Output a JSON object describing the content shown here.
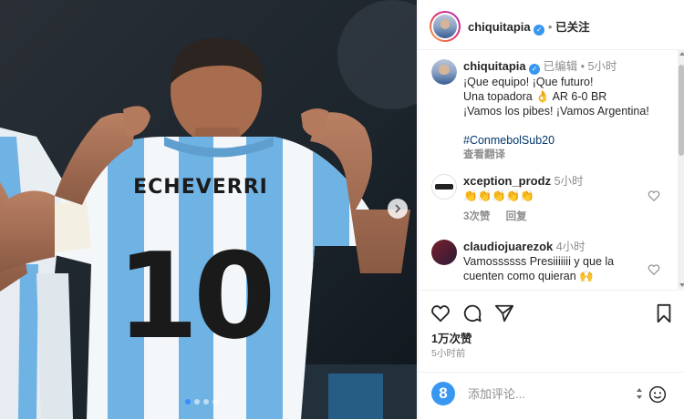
{
  "post_owner": {
    "username": "chiquitapia",
    "verified_icon": "verified-badge-icon",
    "follow_status": "已关注",
    "separator": "•"
  },
  "photo": {
    "jersey_name": "ECHEVERRI",
    "jersey_number": "10",
    "next_icon": "chevron-right-icon",
    "carousel_dots": 4,
    "active_dot": 0
  },
  "caption": {
    "username": "chiquitapia",
    "edited_label": "已编辑",
    "separator": "•",
    "time": "5小时",
    "lines": [
      "¡Que equipo! ¡Que futuro!",
      "Una topadora 👌 AR 6-0 BR",
      "¡Vamos los pibes! ¡Vamos Argentina!"
    ],
    "hashtag": "#ConmebolSub20",
    "translate": "查看翻译"
  },
  "comments": [
    {
      "username": "xception_prodz",
      "time": "5小时",
      "text": "👏👏👏👏👏",
      "likes": "3次赞",
      "reply": "回复"
    },
    {
      "username": "claudiojuarezok",
      "time": "4小时",
      "text": "Vamossssss Presiiiiiii y que la cuenten como quieran 🙌"
    }
  ],
  "actions": {
    "like_icon": "heart-icon",
    "comment_icon": "comment-bubble-icon",
    "share_icon": "paper-plane-icon",
    "save_icon": "bookmark-icon"
  },
  "likes_count": "1万次赞",
  "posted_time": "5小时前",
  "comment_box": {
    "placeholder": "添加评论...",
    "emoji_icon": "emoji-smile-icon"
  },
  "colors": {
    "accent": "#3897f0",
    "hashtag": "#00376b",
    "muted": "#8e8e8e",
    "jersey_blue": "#6fb3e4"
  }
}
